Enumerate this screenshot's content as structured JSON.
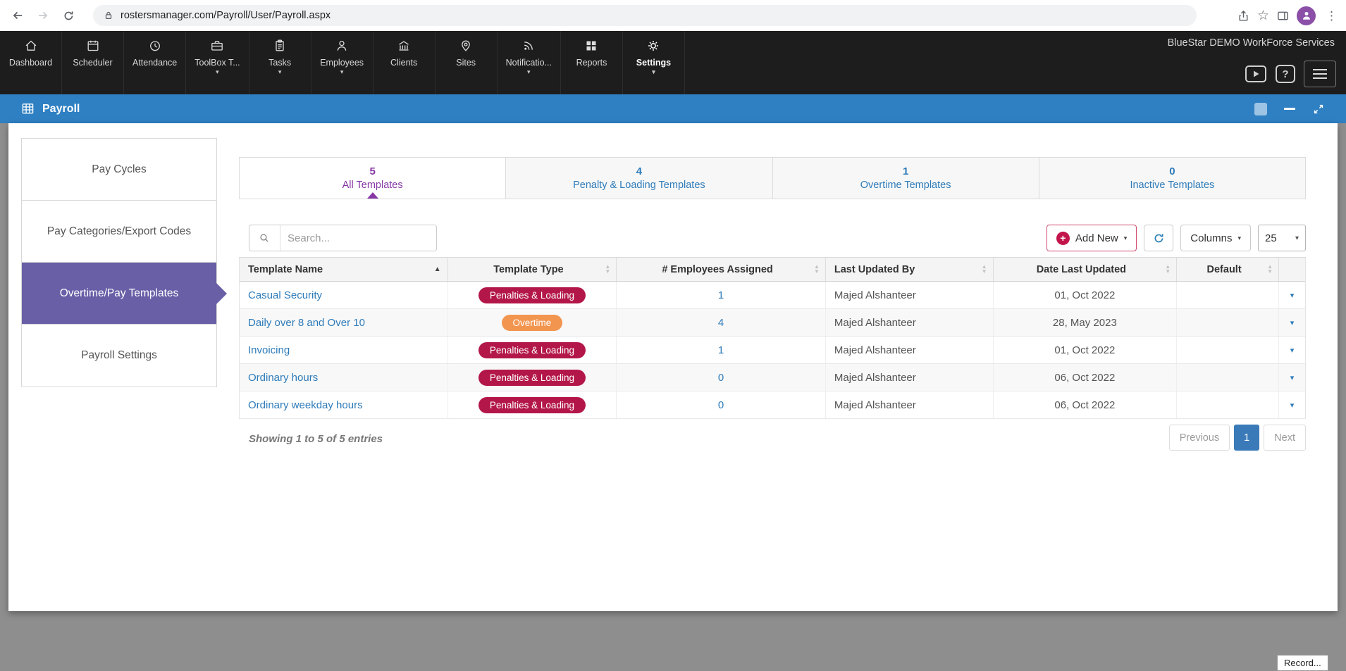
{
  "browser": {
    "url": "rostersmanager.com/Payroll/User/Payroll.aspx"
  },
  "nav": {
    "brand": "BlueStar DEMO WorkForce Services",
    "items": [
      {
        "label": "Dashboard",
        "icon": "home-icon",
        "caret": false,
        "active": false
      },
      {
        "label": "Scheduler",
        "icon": "calendar-icon",
        "caret": false,
        "active": false
      },
      {
        "label": "Attendance",
        "icon": "clock-icon",
        "caret": false,
        "active": false
      },
      {
        "label": "ToolBox T...",
        "icon": "toolbox-icon",
        "caret": true,
        "active": false
      },
      {
        "label": "Tasks",
        "icon": "tasks-icon",
        "caret": true,
        "active": false
      },
      {
        "label": "Employees",
        "icon": "employees-icon",
        "caret": true,
        "active": false
      },
      {
        "label": "Clients",
        "icon": "clients-icon",
        "caret": false,
        "active": false
      },
      {
        "label": "Sites",
        "icon": "sites-icon",
        "caret": false,
        "active": false
      },
      {
        "label": "Notificatio...",
        "icon": "notifications-icon",
        "caret": true,
        "active": false
      },
      {
        "label": "Reports",
        "icon": "reports-icon",
        "caret": false,
        "active": false
      },
      {
        "label": "Settings",
        "icon": "settings-icon",
        "caret": true,
        "active": true
      }
    ]
  },
  "titlebar": {
    "title": "Payroll"
  },
  "sidebar": {
    "items": [
      {
        "label": "Pay Cycles",
        "active": false
      },
      {
        "label": "Pay Categories/Export Codes",
        "active": false
      },
      {
        "label": "Overtime/Pay Templates",
        "active": true
      },
      {
        "label": "Payroll Settings",
        "active": false
      }
    ]
  },
  "tabs": {
    "items": [
      {
        "count": "5",
        "label": "All Templates",
        "active": true
      },
      {
        "count": "4",
        "label": "Penalty & Loading Templates",
        "active": false
      },
      {
        "count": "1",
        "label": "Overtime Templates",
        "active": false
      },
      {
        "count": "0",
        "label": "Inactive Templates",
        "active": false
      }
    ]
  },
  "toolbar": {
    "search_placeholder": "Search...",
    "add_new_label": "Add New",
    "columns_label": "Columns",
    "page_size": "25"
  },
  "table": {
    "headers": {
      "name": "Template Name",
      "type": "Template Type",
      "employees": "# Employees Assigned",
      "updated_by": "Last Updated By",
      "date": "Date Last Updated",
      "default": "Default"
    },
    "rows": [
      {
        "name": "Casual Security",
        "type": "Penalties & Loading",
        "employees": "1",
        "updated_by": "Majed Alshanteer",
        "date": "01, Oct 2022"
      },
      {
        "name": "Daily over 8 and Over 10",
        "type": "Overtime",
        "employees": "4",
        "updated_by": "Majed Alshanteer",
        "date": "28, May 2023"
      },
      {
        "name": "Invoicing",
        "type": "Penalties & Loading",
        "employees": "1",
        "updated_by": "Majed Alshanteer",
        "date": "01, Oct 2022"
      },
      {
        "name": "Ordinary hours",
        "type": "Penalties & Loading",
        "employees": "0",
        "updated_by": "Majed Alshanteer",
        "date": "06, Oct 2022"
      },
      {
        "name": "Ordinary weekday hours",
        "type": "Penalties & Loading",
        "employees": "0",
        "updated_by": "Majed Alshanteer",
        "date": "06, Oct 2022"
      }
    ],
    "footer_text": "Showing 1 to 5 of 5 entries",
    "pagination": {
      "previous": "Previous",
      "page": "1",
      "next": "Next"
    }
  },
  "glyphs": {
    "caret_down": "▾",
    "sort_asc": "▲",
    "sort_up": "▲",
    "sort_down": "▼",
    "star": "☆",
    "overflow_menu": "⋮",
    "plus": "+",
    "help": "?"
  },
  "colors": {
    "title_bar_blue": "#2f80c3",
    "sidebar_active_purple": "#685fa7",
    "tab_active_purple": "#8637a4",
    "link_blue": "#2d7bb9",
    "penalty_badge": "#b3174a",
    "overtime_badge": "#f2954f",
    "add_new_red": "#c2154b",
    "active_page_blue": "#3a7ab8",
    "nav_background": "#1d1d1d"
  },
  "misc": {
    "record_label": "Record..."
  }
}
